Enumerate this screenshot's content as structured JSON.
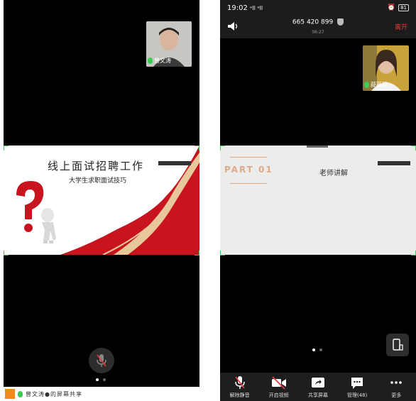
{
  "left_phone": {
    "self_view": {
      "name": "曾文涛",
      "name_display": "曾文涛 ●"
    },
    "slide": {
      "title": "线上面试招聘工作",
      "subtitle": "大学生求职面试技巧"
    },
    "sharing_banner": "曾文涛●的屏幕共享"
  },
  "right_phone": {
    "status": {
      "time": "19:02",
      "signal": "ᵊll ᵊll",
      "battery": "81"
    },
    "meeting": {
      "id": "665 420 899",
      "duration": "06:27",
      "leave_label": "离开"
    },
    "self_view": {
      "name": "薛薇薇"
    },
    "slide": {
      "part": "PART 01",
      "heading": "老师讲解"
    },
    "toolbar": [
      {
        "label": "解除静音",
        "icon": "mic-muted-icon"
      },
      {
        "label": "开启视频",
        "icon": "video-off-icon"
      },
      {
        "label": "共享屏幕",
        "icon": "share-screen-icon"
      },
      {
        "label": "管理(48)",
        "icon": "chat-icon"
      },
      {
        "label": "更多",
        "icon": "more-icon"
      }
    ]
  },
  "colors": {
    "slide_red": "#c8141e",
    "status_green": "#3ecb57",
    "part_orange": "#e0a98a"
  }
}
